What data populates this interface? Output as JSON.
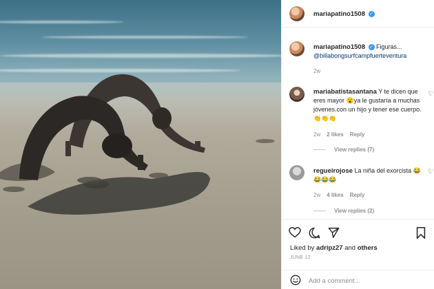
{
  "post": {
    "author": "mariapatino1508",
    "caption_username": "mariapatino1508",
    "caption_text": "Figuras...",
    "caption_link": "@billabongsurfcampfuerteventura",
    "caption_age": "2w"
  },
  "comments": [
    {
      "username": "mariabatistasantana",
      "text": "Y te dicen que eres mayor 😮ya le gustaría a muchas jóvenes.con un hijo y tener ese cuerpo.👏👏👏",
      "age": "2w",
      "likes": "2 likes",
      "reply_label": "Reply",
      "view_replies": "View replies (7)"
    },
    {
      "username": "regueirojose",
      "text": "La niña del exorcista 😂😂😂😂",
      "age": "2w",
      "likes": "4 likes",
      "reply_label": "Reply",
      "view_replies": "View replies (2)"
    }
  ],
  "likes": {
    "prefix": "Liked by",
    "user": "adripz27",
    "and": "and",
    "others": "others"
  },
  "date": "JUNE 12",
  "add_comment": {
    "placeholder": "Add a comment..."
  },
  "icons": {
    "like": "heart-icon",
    "comment": "comment-icon",
    "share": "share-icon",
    "save": "bookmark-icon",
    "emoji": "smiley-icon"
  },
  "colors": {
    "verified": "#3897f0",
    "link": "#00376b",
    "meta": "#8e8e8e"
  }
}
